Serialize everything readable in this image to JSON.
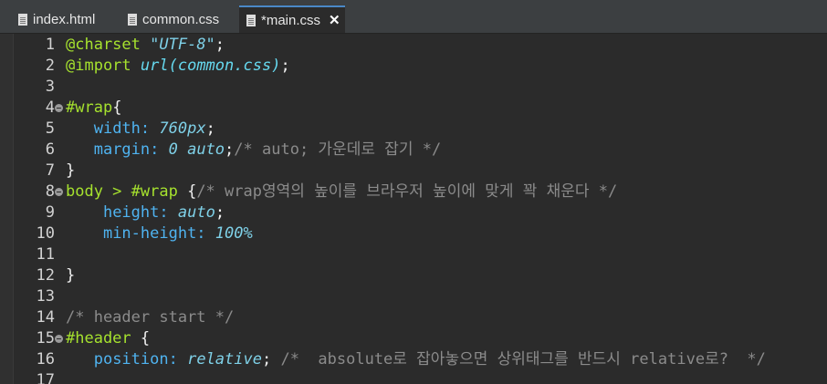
{
  "tabs": [
    {
      "label": "index.html",
      "active": false
    },
    {
      "label": "common.css",
      "active": false
    },
    {
      "label": "*main.css",
      "active": true,
      "close": "✕"
    }
  ],
  "lines": [
    {
      "n": "1",
      "parts": [
        [
          "at",
          "@charset"
        ],
        [
          "plain",
          " "
        ],
        [
          "str",
          "\"UTF-8\""
        ],
        [
          "plain",
          ";"
        ]
      ]
    },
    {
      "n": "2",
      "parts": [
        [
          "at",
          "@import"
        ],
        [
          "plain",
          " "
        ],
        [
          "fn",
          "url(common.css)"
        ],
        [
          "plain",
          ";"
        ]
      ]
    },
    {
      "n": "3",
      "parts": []
    },
    {
      "n": "4",
      "fold": true,
      "parts": [
        [
          "sel",
          "#wrap"
        ],
        [
          "plain",
          "{"
        ]
      ]
    },
    {
      "n": "5",
      "parts": [
        [
          "plain",
          "   "
        ],
        [
          "prop",
          "width:"
        ],
        [
          "plain",
          " "
        ],
        [
          "val",
          "760px"
        ],
        [
          "plain",
          ";"
        ]
      ]
    },
    {
      "n": "6",
      "parts": [
        [
          "plain",
          "   "
        ],
        [
          "prop",
          "margin:"
        ],
        [
          "plain",
          " "
        ],
        [
          "val",
          "0 auto"
        ],
        [
          "plain",
          ";"
        ],
        [
          "cm",
          "/* auto; 가운데로 잡기 */"
        ]
      ]
    },
    {
      "n": "7",
      "parts": [
        [
          "plain",
          "}"
        ]
      ]
    },
    {
      "n": "8",
      "fold": true,
      "parts": [
        [
          "sel",
          "body > #wrap"
        ],
        [
          "plain",
          " {"
        ],
        [
          "cm",
          "/* wrap영역의 높이를 브라우저 높이에 맞게 꽉 채운다 */"
        ]
      ]
    },
    {
      "n": "9",
      "parts": [
        [
          "plain",
          "    "
        ],
        [
          "prop",
          "height:"
        ],
        [
          "plain",
          " "
        ],
        [
          "val",
          "auto"
        ],
        [
          "plain",
          ";"
        ]
      ]
    },
    {
      "n": "10",
      "parts": [
        [
          "plain",
          "    "
        ],
        [
          "prop",
          "min-height:"
        ],
        [
          "plain",
          " "
        ],
        [
          "val",
          "100%"
        ]
      ]
    },
    {
      "n": "11",
      "parts": []
    },
    {
      "n": "12",
      "parts": [
        [
          "plain",
          "}"
        ]
      ]
    },
    {
      "n": "13",
      "parts": []
    },
    {
      "n": "14",
      "parts": [
        [
          "cm",
          "/* header start */"
        ]
      ]
    },
    {
      "n": "15",
      "fold": true,
      "parts": [
        [
          "sel",
          "#header"
        ],
        [
          "plain",
          " {"
        ]
      ]
    },
    {
      "n": "16",
      "parts": [
        [
          "plain",
          "   "
        ],
        [
          "prop",
          "position:"
        ],
        [
          "plain",
          " "
        ],
        [
          "val",
          "relative"
        ],
        [
          "plain",
          "; "
        ],
        [
          "cm",
          "/*  absolute로 잡아놓으면 상위태그를 반드시 relative로?  */"
        ]
      ]
    },
    {
      "n": "17",
      "parts": []
    }
  ]
}
